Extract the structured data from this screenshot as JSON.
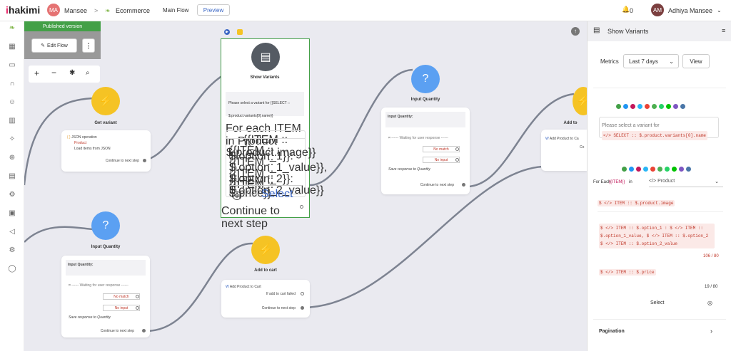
{
  "topbar": {
    "brand_prefix": "i",
    "brand": "hakimi",
    "ws_initials": "MA",
    "workspace": "Mansee",
    "sep": ">",
    "project": "Ecommerce",
    "flow": "Main Flow",
    "preview": "Preview",
    "notif_count": "0",
    "user_initials": "AM",
    "user_name": "Adhiya Mansee"
  },
  "toolbar": {
    "published": "Published version",
    "edit_flow": "Edit Flow",
    "more": "⋮"
  },
  "nodes": {
    "get_variant": {
      "title": "Get variant",
      "op": "JSON operation",
      "product": "Product",
      "desc": "Load items from JSON",
      "cont": "Continue to next step"
    },
    "show_variants": {
      "title": "Show Variants",
      "msg": "Please select a variant for {{SELECT :: $.product.variants[0].name}}",
      "for_each": "For each ITEM in Product",
      "item_image": "{{ITEM :: $.product.image}}",
      "item_opts": "{{ITEM :: $.option_1}}: {{ITEM :: $.option_1_value}}, {{ITEM :: $.option_2}}: {{ITEM :: $.option_2_value}}",
      "item_price": "{{ITEM :: $.price}}",
      "select": "Select",
      "cont": "Continue to next step"
    },
    "input_qty1": {
      "title": "Input Quantity",
      "label": "Input Quantity:",
      "waiting": "------ Waiting for user response ------",
      "no_match": "No match",
      "no_input": "No input",
      "save": "Save response to Quantity",
      "cont": "Continue to next step"
    },
    "input_qty2": {
      "title": "Input Quantity",
      "label": "Input Quantity:",
      "waiting": "------ Waiting for user response ------",
      "no_match": "No match",
      "no_input": "No input",
      "save": "Save response to Quantity",
      "cont": "Continue to next step"
    },
    "add_cart": {
      "title": "Add to cart",
      "action": "Add Product to Cart",
      "failed": "If add to cart failed",
      "cont": "Continue to next step"
    },
    "add_to": {
      "title": "Add to",
      "action": "Add Product to Ca",
      "cont": "Co"
    }
  },
  "panel": {
    "title": "Show Variants",
    "metrics": "Metrics",
    "period": "Last 7 days",
    "view": "View",
    "msg_prefix": "Please select a variant for ",
    "msg_chip": "</> SELECT :: $.product.variants[0].name",
    "for_each": "For Each",
    "item_var": "{{ITEM}}",
    "in": "in",
    "source": "</> Product",
    "chip_image": "$ </> ITEM :: $.product.image",
    "opt_text": "$ </> ITEM :: $.option_1 : $ </> ITEM :: $.option_1_value, $ </> ITEM :: $.option_2 $ </> ITEM :: $.option_2_value",
    "count1": "106 / 80",
    "chip_price": "$ </> ITEM :: $.price",
    "count2": "19 / 80",
    "select": "Select",
    "pagination": "Pagination"
  },
  "colors": {
    "yellow": "#f5c324",
    "blue": "#5ba0f2",
    "dark": "#555b63",
    "green": "#43a047"
  }
}
